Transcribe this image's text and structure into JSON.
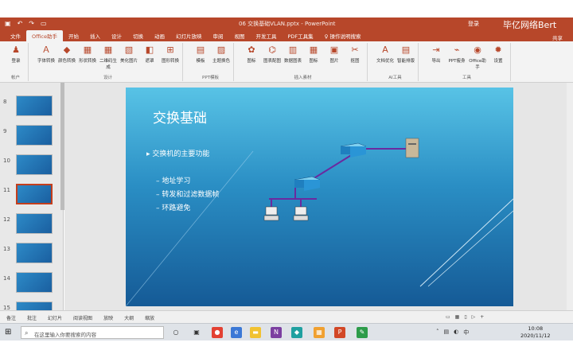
{
  "titlebar": {
    "doc_title": "06 交换基础VLAN.pptx - PowerPoint",
    "user": "登录",
    "watermark": "毕亿网络Bert"
  },
  "tabs": [
    "文件",
    "Office助手",
    "开始",
    "插入",
    "设计",
    "切换",
    "动画",
    "幻灯片放映",
    "审阅",
    "视图",
    "开发工具",
    "PDF工具集",
    "♀ 操作说明搜索"
  ],
  "tabs_active": "Office助手",
  "share": "共享",
  "ribbon": {
    "groups": [
      {
        "label": "帐户",
        "buttons": [
          "登录"
        ]
      },
      {
        "label": "设计",
        "buttons": [
          "字体转换",
          "颜色转换",
          "形状转换",
          "二维码生成",
          "美化图片",
          "遮罩",
          "图形转换"
        ]
      },
      {
        "label": "PPT模板",
        "buttons": [
          "模板",
          "主题换色"
        ]
      },
      {
        "label": "插入素材",
        "buttons": [
          "图标",
          "图表配图",
          "数据图表",
          "图标",
          "图片",
          "抠图"
        ]
      },
      {
        "label": "AI工具",
        "buttons": [
          "文档优化",
          "智能排版"
        ]
      },
      {
        "label": "工具",
        "buttons": [
          "导出",
          "PPT瘦身",
          "Office助手",
          "设置"
        ]
      }
    ]
  },
  "slides_panel": {
    "numbers": [
      "8",
      "9",
      "10",
      "11",
      "12",
      "13",
      "14",
      "15"
    ],
    "selected": "11"
  },
  "slide": {
    "title": "交换基础",
    "bullet": "▸ 交换机的主要功能",
    "subitems": [
      "– 地址学习",
      "– 转发和过滤数据帧",
      "– 环路避免"
    ]
  },
  "status": {
    "items": [
      "备注",
      "批注",
      "幻灯片",
      "阅读视图",
      "放映",
      "大纲",
      "缩放"
    ],
    "zoom": "+"
  },
  "taskbar": {
    "search_placeholder": "在这里输入你要搜索的内容",
    "time": "10:08",
    "date": "2020/11/12"
  }
}
